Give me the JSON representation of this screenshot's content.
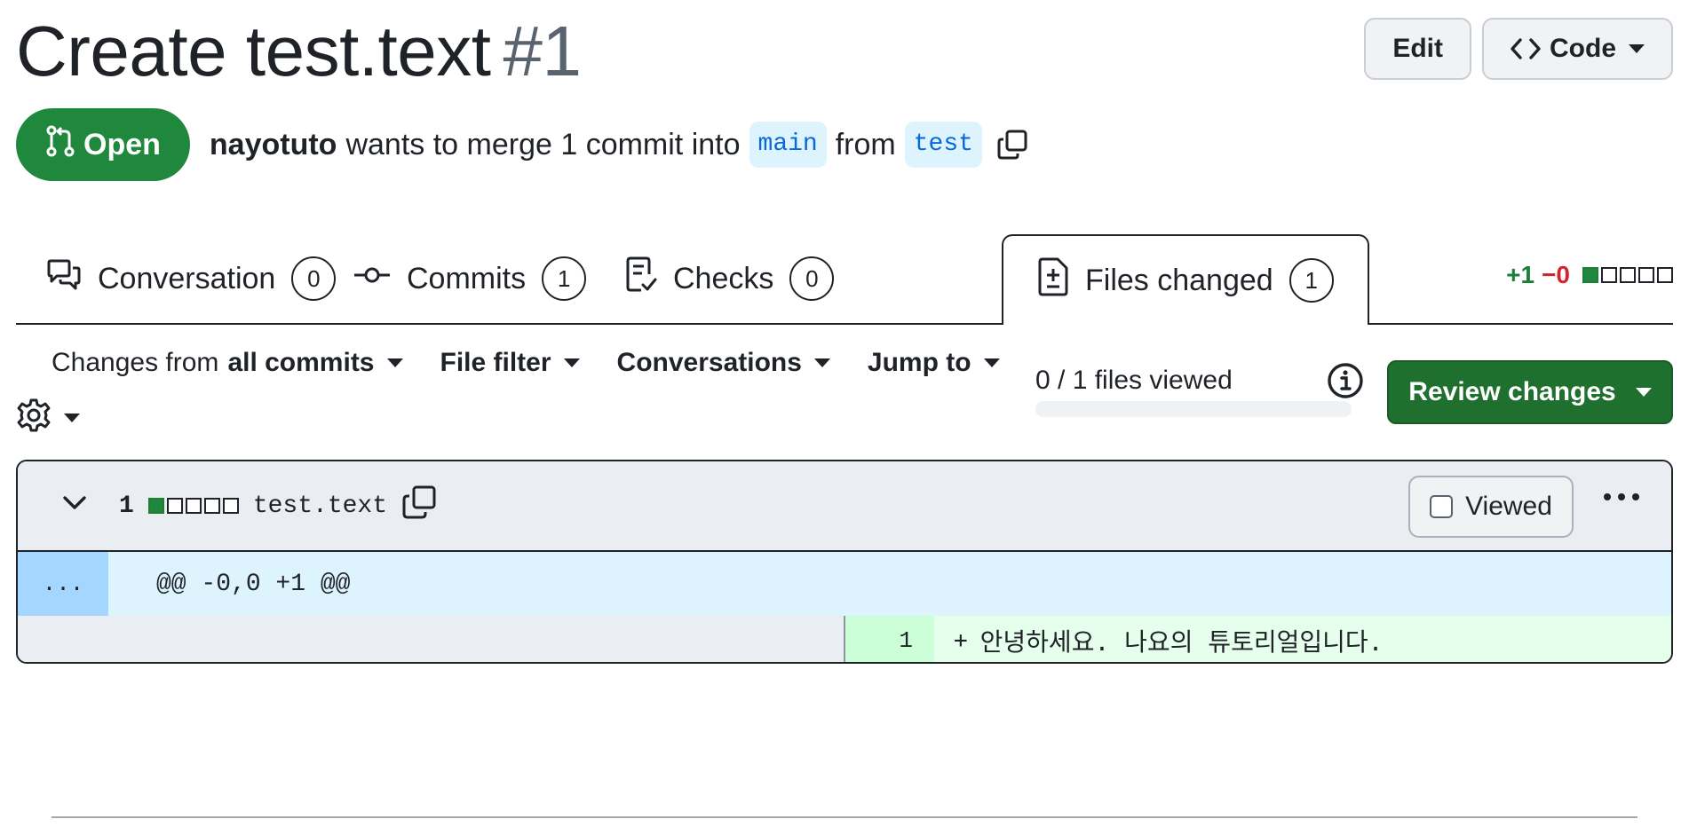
{
  "header": {
    "title": "Create test.text",
    "number": "#1",
    "edit_label": "Edit",
    "code_label": "Code"
  },
  "status": {
    "state": "Open",
    "author": "nayotuto",
    "message": "wants to merge 1 commit into",
    "base_branch": "main",
    "from_word": "from",
    "head_branch": "test"
  },
  "tabs": [
    {
      "label": "Conversation",
      "count": "0",
      "icon": "comment-discussion-icon"
    },
    {
      "label": "Commits",
      "count": "1",
      "icon": "git-commit-icon"
    },
    {
      "label": "Checks",
      "count": "0",
      "icon": "checklist-icon"
    },
    {
      "label": "Files changed",
      "count": "1",
      "icon": "file-diff-icon",
      "selected": true
    }
  ],
  "diffstat": {
    "additions": "+1",
    "deletions": "−0"
  },
  "toolbar": {
    "changes_prefix": "Changes from",
    "changes_value": "all commits",
    "file_filter": "File filter",
    "conversations": "Conversations",
    "jump_to": "Jump to",
    "files_viewed": "0 / 1 files viewed",
    "files_viewed_progress": 0,
    "review_changes": "Review changes"
  },
  "file": {
    "change_count": "1",
    "path": "test.text",
    "viewed_label": "Viewed",
    "hunk_expander": "...",
    "hunk_header": "@@ -0,0 +1 @@",
    "line_number": "1",
    "line_marker": "+",
    "line_content": "안녕하세요. 나요의 튜토리얼입니다."
  },
  "colors": {
    "open_green": "#1f883d",
    "review_button": "#1f6f2e",
    "addition_bg": "#e6ffec",
    "hunk_bg": "#ddf4ff",
    "branch_text": "#0969da"
  }
}
